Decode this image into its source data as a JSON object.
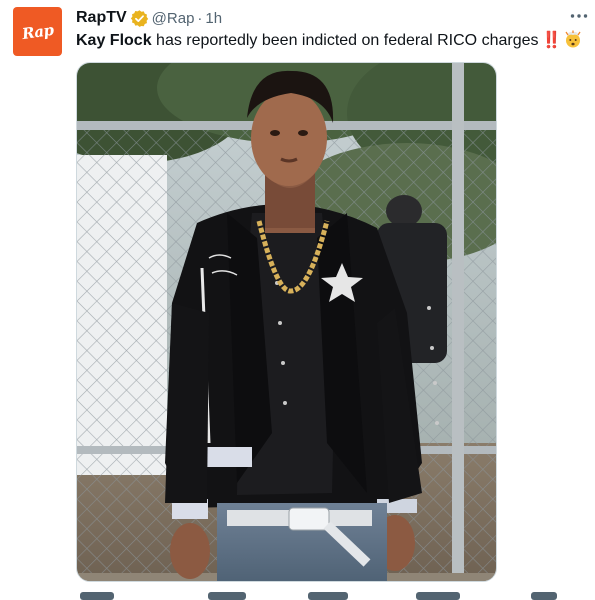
{
  "tweet": {
    "display_name": "RapTV",
    "handle": "@Rap",
    "separator": "·",
    "time": "1h",
    "avatar_text": "Rap",
    "text_bold": "Kay Flock",
    "text_rest": " has reportedly been indicted on federal RICO charges",
    "text_emoji_bang": "‼️",
    "text_emoji_face": "exploding-head-emoji"
  },
  "icons": {
    "verified": "verified-badge-icon",
    "more": "more-options-icon"
  },
  "colors": {
    "avatar_bg": "#ef5a24",
    "verified_badge": "#e9b31f",
    "text_primary": "#0f1419",
    "text_secondary": "#536471"
  }
}
